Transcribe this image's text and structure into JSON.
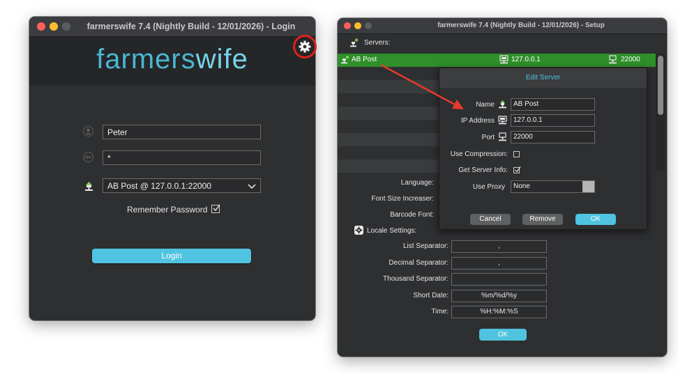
{
  "login_window": {
    "title": "farmerswife 7.4  (Nightly Build - 12/01/2026) - Login",
    "logo_part1": "farmers",
    "logo_part2": "wife",
    "username_value": "Peter",
    "password_value": "*",
    "server_value": "AB Post @ 127.0.0.1:22000",
    "remember_label": "Remember Password",
    "remember_checked": true,
    "login_button": "Login",
    "icons": [
      "user-icon",
      "key-icon",
      "server-icon",
      "chevron-down-icon",
      "gear-icon"
    ]
  },
  "setup_window": {
    "title": "farmerswife 7.4  (Nightly Build - 12/01/2026) - Setup",
    "servers_label": "Servers:",
    "selected_server": {
      "name": "AB Post",
      "ip": "127.0.0.1",
      "port": "22000"
    },
    "language_label": "Language:",
    "font_size_label": "Font Size Increaser:",
    "barcode_font_label": "Barcode Font:",
    "locale_settings_label": "Locale Settings:",
    "locale": [
      {
        "label": "List Separator:",
        "value": ","
      },
      {
        "label": "Decimal Separator:",
        "value": ","
      },
      {
        "label": "Thousand Separator:",
        "value": ""
      },
      {
        "label": "Short Date:",
        "value": "%m/%d/%y"
      },
      {
        "label": "Time:",
        "value": "%H:%M:%S"
      }
    ],
    "ok_button": "OK"
  },
  "edit_server": {
    "title": "Edit Server",
    "name_label": "Name",
    "name_value": "AB Post",
    "ip_label": "IP Address",
    "ip_value": "127.0.0.1",
    "port_label": "Port",
    "port_value": "22000",
    "use_compression_label": "Use Compression:",
    "use_compression_checked": false,
    "get_server_info_label": "Get Server Info:",
    "get_server_info_checked": true,
    "use_proxy_label": "Use Proxy",
    "use_proxy_value": "None",
    "cancel_button": "Cancel",
    "remove_button": "Remove",
    "ok_button": "OK"
  },
  "colors": {
    "accent": "#4fc3df",
    "selected_row": "#2f8f2a",
    "highlight_ring": "#e0211b",
    "arrow": "#e53a2a"
  }
}
